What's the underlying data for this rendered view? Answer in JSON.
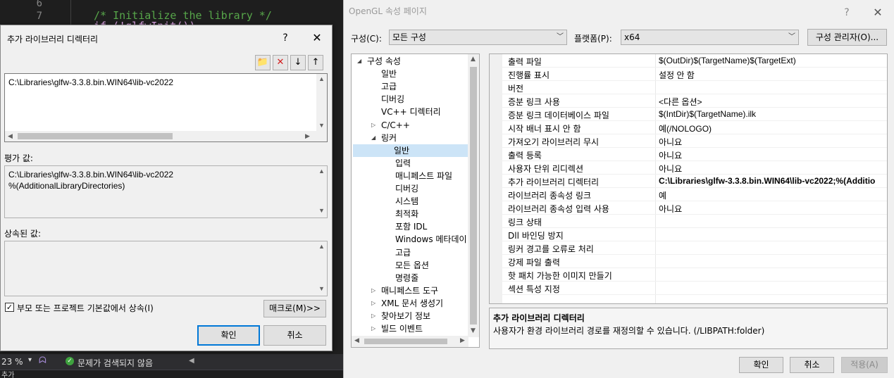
{
  "editor": {
    "line_numbers": [
      "6",
      "7"
    ],
    "code_lines": [
      "/* Initialize the library */",
      "if (!glfwInit())"
    ],
    "status": {
      "zoom": "23 %",
      "message": "문제가 검색되지 않음"
    },
    "bottom_text": "추가"
  },
  "lib_dialog": {
    "title": "추가 라이브러리 디렉터리",
    "help": "?",
    "close": "✕",
    "toolbar": {
      "new_folder": "📁",
      "delete": "✕",
      "move_down": "↓",
      "move_up": "↑"
    },
    "input_value": "C:\\Libraries\\glfw-3.3.8.bin.WIN64\\lib-vc2022",
    "evaluated_label": "평가 값:",
    "evaluated_lines": [
      "C:\\Libraries\\glfw-3.3.8.bin.WIN64\\lib-vc2022",
      "%(AdditionalLibraryDirectories)"
    ],
    "inherited_label": "상속된 값:",
    "inherit_checkbox_label": "부모 또는 프로젝트 기본값에서 상속(I)",
    "inherit_checked": true,
    "macro_button": "매크로(M)>>",
    "ok_button": "확인",
    "cancel_button": "취소"
  },
  "property_pages": {
    "title": "OpenGL 속성 페이지",
    "help": "?",
    "close": "✕",
    "config_label": "구성(C):",
    "config_value": "모든 구성",
    "platform_label": "플랫폼(P):",
    "platform_value": "x64",
    "config_manager_button": "구성 관리자(O)...",
    "tree": [
      {
        "label": "구성 속성",
        "level": 0,
        "expanded": true
      },
      {
        "label": "일반",
        "level": 1
      },
      {
        "label": "고급",
        "level": 1
      },
      {
        "label": "디버깅",
        "level": 1
      },
      {
        "label": "VC++ 디렉터리",
        "level": 1
      },
      {
        "label": "C/C++",
        "level": 1,
        "expandable": true
      },
      {
        "label": "링커",
        "level": 1,
        "expanded": true
      },
      {
        "label": "일반",
        "level": 2,
        "selected": true
      },
      {
        "label": "입력",
        "level": 2
      },
      {
        "label": "매니페스트 파일",
        "level": 2
      },
      {
        "label": "디버깅",
        "level": 2
      },
      {
        "label": "시스템",
        "level": 2
      },
      {
        "label": "최적화",
        "level": 2
      },
      {
        "label": "포함 IDL",
        "level": 2
      },
      {
        "label": "Windows 메타데이",
        "level": 2
      },
      {
        "label": "고급",
        "level": 2
      },
      {
        "label": "모든 옵션",
        "level": 2
      },
      {
        "label": "명령줄",
        "level": 2
      },
      {
        "label": "매니페스트 도구",
        "level": 1,
        "expandable": true
      },
      {
        "label": "XML 문서 생성기",
        "level": 1,
        "expandable": true
      },
      {
        "label": "찾아보기 정보",
        "level": 1,
        "expandable": true
      },
      {
        "label": "빌드 이벤트",
        "level": 1,
        "expandable": true
      }
    ],
    "grid": [
      {
        "name": "출력 파일",
        "value": "$(OutDir)$(TargetName)$(TargetExt)"
      },
      {
        "name": "진행률 표시",
        "value": "설정 안 함"
      },
      {
        "name": "버전",
        "value": ""
      },
      {
        "name": "증분 링크 사용",
        "value": "<다른 옵션>"
      },
      {
        "name": "증분 링크 데이터베이스 파일",
        "value": "$(IntDir)$(TargetName).ilk"
      },
      {
        "name": "시작 배너 표시 안 함",
        "value": "예(/NOLOGO)"
      },
      {
        "name": "가져오기 라이브러리 무시",
        "value": "아니요"
      },
      {
        "name": "출력 등록",
        "value": "아니요"
      },
      {
        "name": "사용자 단위 리디렉션",
        "value": "아니요"
      },
      {
        "name": "추가 라이브러리 디렉터리",
        "value": "C:\\Libraries\\glfw-3.3.8.bin.WIN64\\lib-vc2022;%(Additio",
        "bold": true
      },
      {
        "name": "라이브러리 종속성 링크",
        "value": "예"
      },
      {
        "name": "라이브러리 종속성 입력 사용",
        "value": "아니요"
      },
      {
        "name": "링크 상태",
        "value": ""
      },
      {
        "name": "Dll 바인딩 방지",
        "value": ""
      },
      {
        "name": "링커 경고를 오류로 처리",
        "value": ""
      },
      {
        "name": "강제 파일 출력",
        "value": ""
      },
      {
        "name": "핫 패치 가능한 이미지 만들기",
        "value": ""
      },
      {
        "name": "섹션 특성 지정",
        "value": ""
      }
    ],
    "description_title": "추가 라이브러리 디렉터리",
    "description_text": "사용자가 환경 라이브러리 경로를 재정의할 수 있습니다. (/LIBPATH:folder)",
    "ok_button": "확인",
    "cancel_button": "취소",
    "apply_button": "적용(A)"
  },
  "colors": {
    "accent": "#0078d7",
    "selection": "#cce4f7",
    "editor_bg": "#1e1e1e",
    "comment": "#57a64a"
  }
}
